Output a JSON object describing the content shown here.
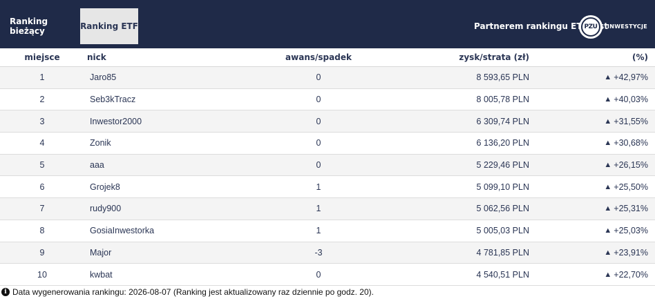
{
  "tabs": [
    {
      "label": "Ranking bieżący",
      "active": false
    },
    {
      "label": "Ranking ETF",
      "active": true
    }
  ],
  "partner": {
    "text": "Partnerem rankingu ETF jest",
    "logo_mark": "PZU",
    "logo_name": "INWESTYCJE"
  },
  "table": {
    "columns": {
      "place": "miejsce",
      "nick": "nick",
      "move": "awans/spadek",
      "profit": "zysk/strata (zł)",
      "pct": "(%)"
    },
    "rows": [
      {
        "place": "1",
        "nick": "Jaro85",
        "move": "0",
        "profit": "8 593,65 PLN",
        "pct": "+42,97%",
        "trend": "up"
      },
      {
        "place": "2",
        "nick": "Seb3kTracz",
        "move": "0",
        "profit": "8 005,78 PLN",
        "pct": "+40,03%",
        "trend": "up"
      },
      {
        "place": "3",
        "nick": "Inwestor2000",
        "move": "0",
        "profit": "6 309,74 PLN",
        "pct": "+31,55%",
        "trend": "up"
      },
      {
        "place": "4",
        "nick": "Zonik",
        "move": "0",
        "profit": "6 136,20 PLN",
        "pct": "+30,68%",
        "trend": "up"
      },
      {
        "place": "5",
        "nick": "aaa",
        "move": "0",
        "profit": "5 229,46 PLN",
        "pct": "+26,15%",
        "trend": "up"
      },
      {
        "place": "6",
        "nick": "Grojek8",
        "move": "1",
        "profit": "5 099,10 PLN",
        "pct": "+25,50%",
        "trend": "up"
      },
      {
        "place": "7",
        "nick": "rudy900",
        "move": "1",
        "profit": "5 062,56 PLN",
        "pct": "+25,31%",
        "trend": "up"
      },
      {
        "place": "8",
        "nick": "GosiaInwestorka",
        "move": "1",
        "profit": "5 005,03 PLN",
        "pct": "+25,03%",
        "trend": "up"
      },
      {
        "place": "9",
        "nick": "Major",
        "move": "-3",
        "profit": "4 781,85 PLN",
        "pct": "+23,91%",
        "trend": "up"
      },
      {
        "place": "10",
        "nick": "kwbat",
        "move": "0",
        "profit": "4 540,51 PLN",
        "pct": "+22,70%",
        "trend": "up"
      }
    ]
  },
  "footer": {
    "icon": "info-icon",
    "text": "Data wygenerowania rankingu: 2026-08-07 (Ranking jest aktualizowany raz dziennie po godz. 20)."
  },
  "colors": {
    "header_bg": "#1f2a48",
    "active_tab_bg": "#e6e6e6",
    "row_stripe": "#f4f4f4",
    "text": "#2a3554"
  }
}
